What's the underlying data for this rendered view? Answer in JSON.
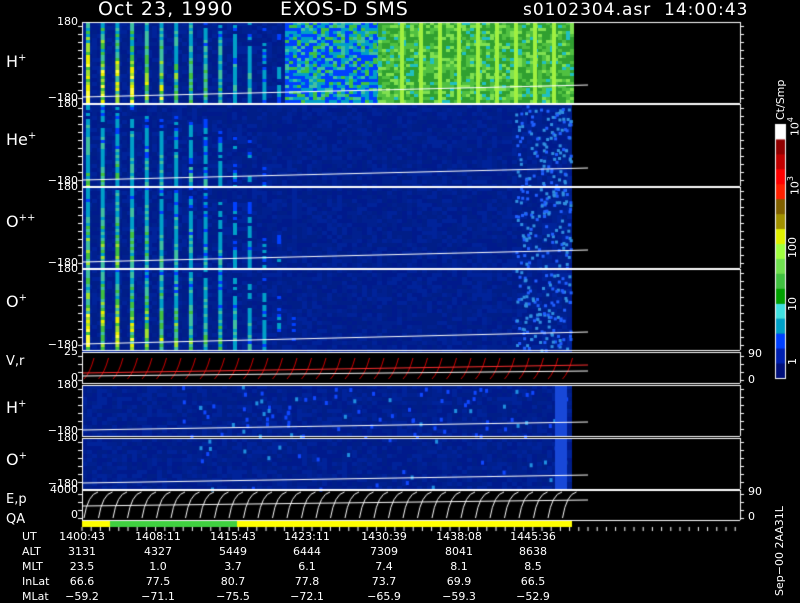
{
  "header": {
    "date": "Oct 23, 1990",
    "instrument": "EXOS-D SMS",
    "file_time": "s0102304.asr  14:00:43"
  },
  "colorbar": {
    "label": "Ct/Smp",
    "ticks": [
      "1",
      "10",
      "100",
      "10",
      "10"
    ],
    "tick_exponents": [
      "",
      "",
      "",
      "3",
      "4"
    ],
    "colors": [
      "#000f7a",
      "#0020b0",
      "#0040ff",
      "#00a0c8",
      "#40e0e0",
      "#00a000",
      "#40c040",
      "#70e050",
      "#a0ff40",
      "#e0f000",
      "#a09000",
      "#806000",
      "#ff2000",
      "#ff0000",
      "#c00000",
      "#900000",
      "#ffffff"
    ]
  },
  "panels": [
    {
      "label": "H",
      "sup": "+",
      "ymax": "180",
      "ymin": "−180"
    },
    {
      "label": "He",
      "sup": "+",
      "ymax": "180",
      "ymin": "−180"
    },
    {
      "label": "O",
      "sup": "++",
      "ymax": "180",
      "ymin": "−180"
    },
    {
      "label": "O",
      "sup": "+",
      "ymax": "180",
      "ymin": "−180"
    },
    {
      "label": "V,r",
      "sup": "",
      "ymax": "25",
      "ymin": "0",
      "right_top": "90",
      "right_bottom": "0"
    },
    {
      "label": "H",
      "sup": "+",
      "ymax": "180",
      "ymin": "−180"
    },
    {
      "label": "O",
      "sup": "+",
      "ymax": "180",
      "ymin": "−180"
    },
    {
      "label": "E,p",
      "sup": "",
      "ymax": "4000",
      "ymin": "0",
      "right_top": "90",
      "right_bottom": "0"
    },
    {
      "label": "QA",
      "sup": ""
    }
  ],
  "chart_data": {
    "type": "heatmap",
    "title": "Oct 23, 1990  EXOS-D SMS",
    "columns": [
      {
        "label": "UT",
        "values": [
          "1400:43",
          "1408:11",
          "1415:43",
          "1423:11",
          "1430:39",
          "1438:08",
          "1445:36"
        ]
      },
      {
        "label": "ALT",
        "values": [
          "3131",
          "4327",
          "5449",
          "6444",
          "7309",
          "8041",
          "8638"
        ]
      },
      {
        "label": "MLT",
        "values": [
          "23.5",
          "1.0",
          "3.7",
          "6.1",
          "7.4",
          "8.1",
          "8.5"
        ]
      },
      {
        "label": "InLat",
        "values": [
          "66.6",
          "77.5",
          "80.7",
          "77.8",
          "73.7",
          "69.9",
          "66.5"
        ]
      },
      {
        "label": "MLat",
        "values": [
          "−59.2",
          "−71.1",
          "−75.5",
          "−72.1",
          "−65.9",
          "−59.3",
          "−52.9"
        ]
      }
    ],
    "qa_segments": [
      {
        "from": "1400:43",
        "to": "1408:11",
        "color": "#ffff00"
      },
      {
        "from": "1408:11",
        "to": "1415:43",
        "color": "#40d040"
      },
      {
        "from": "1415:43",
        "to": "1445:36",
        "color": "#ffff00"
      }
    ]
  },
  "footnote": "Sep−00  2AA31L"
}
